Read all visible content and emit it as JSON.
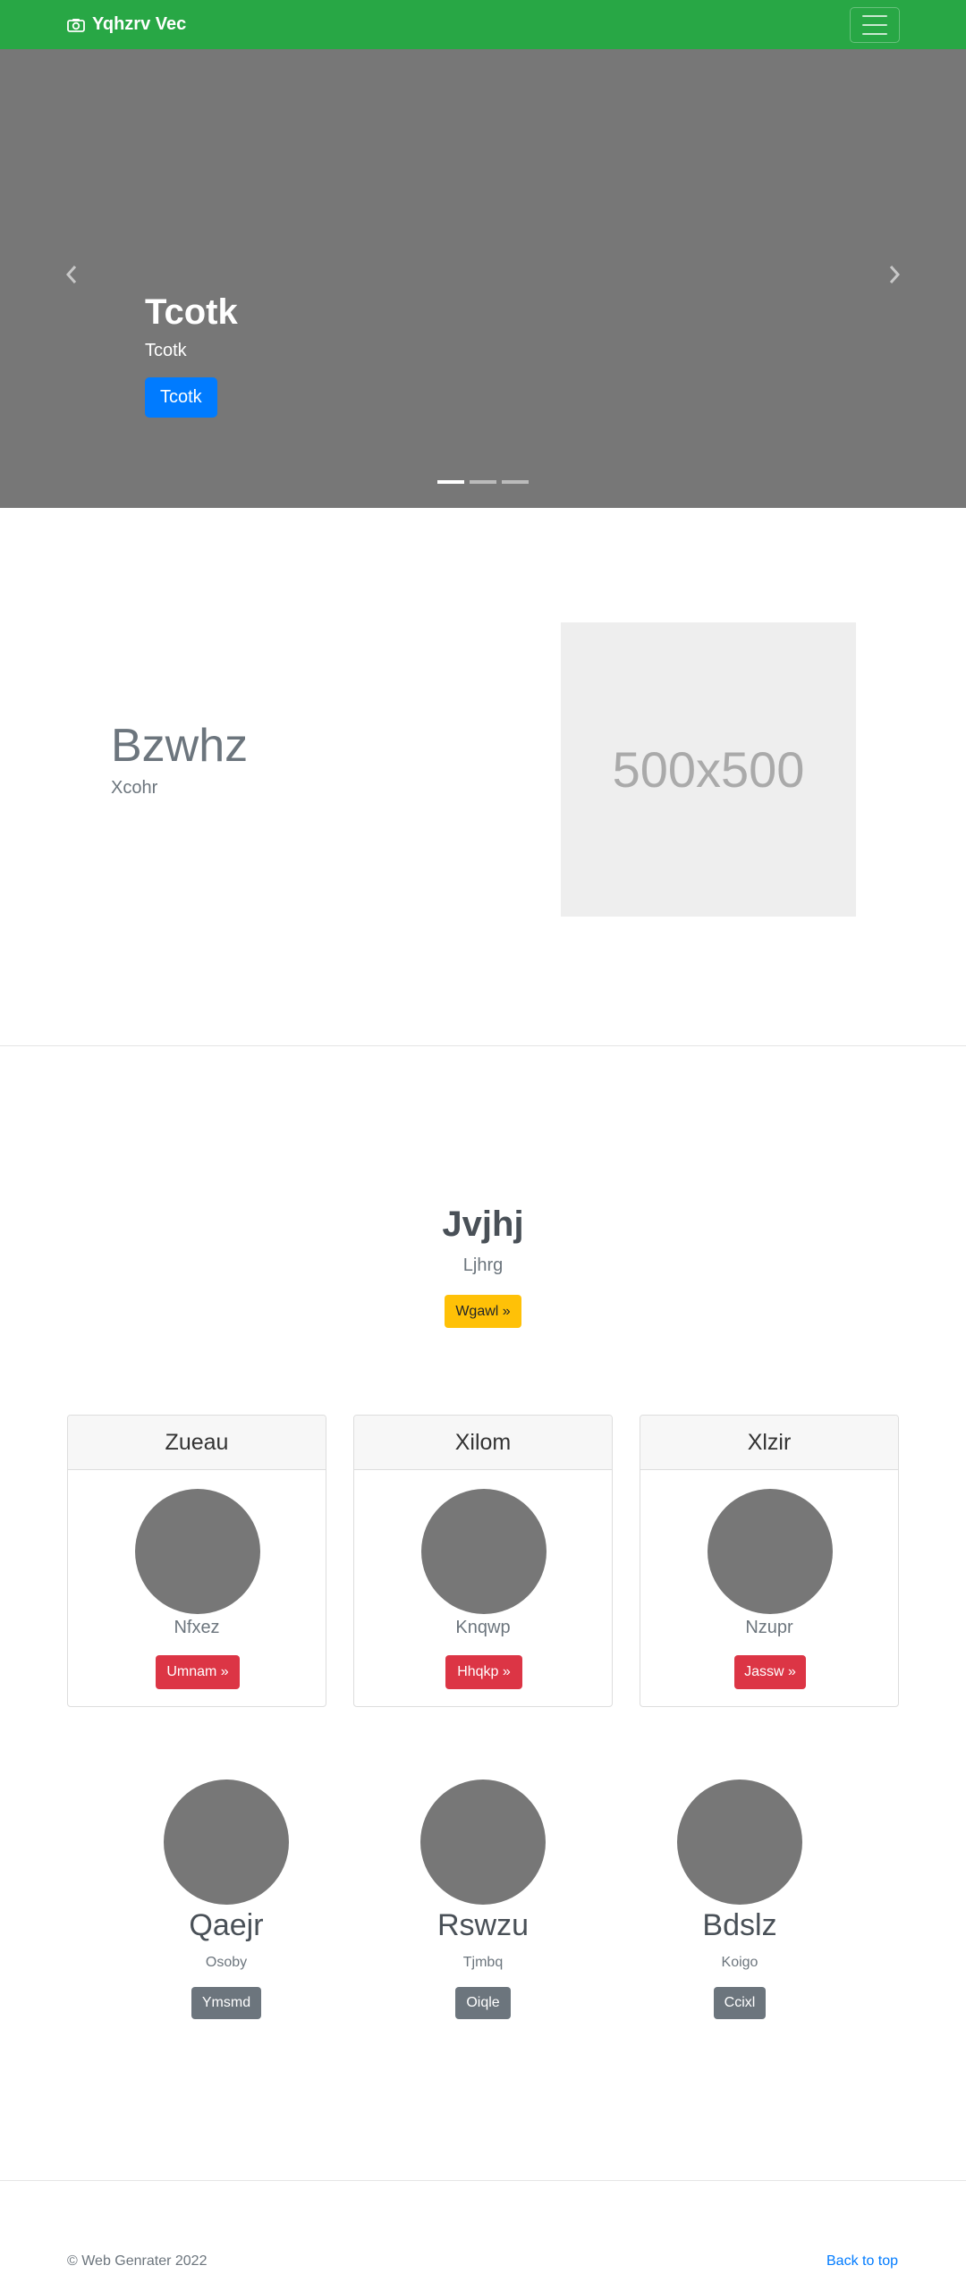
{
  "navbar": {
    "brand": "Yqhzrv Vec",
    "brand_icon": "camera-icon",
    "toggler_icon": "hamburger-icon",
    "bg_color": "#28a745"
  },
  "carousel": {
    "title": "Tcotk",
    "text": "Tcotk",
    "button": "Tcotk",
    "indicators": 3,
    "active_slide": 1,
    "prev_icon": "chevron-left-icon",
    "next_icon": "chevron-right-icon"
  },
  "featurette": {
    "heading": "Bzwhz",
    "lead": "Xcohr",
    "image_label": "500x500"
  },
  "jumbotron": {
    "title": "Jvjhj",
    "lead": "Ljhrg",
    "button": "Wgawl »"
  },
  "cards": [
    {
      "header": "Zueau",
      "text": "Nfxez",
      "button": "Umnam »"
    },
    {
      "header": "Xilom",
      "text": "Knqwp",
      "button": "Hhqkp »"
    },
    {
      "header": "Xlzir",
      "text": "Nzupr",
      "button": "Jassw »"
    }
  ],
  "people": [
    {
      "name": "Qaejr",
      "text": "Osoby",
      "button": "Ymsmd"
    },
    {
      "name": "Rswzu",
      "text": "Tjmbq",
      "button": "Oiqle"
    },
    {
      "name": "Bdslz",
      "text": "Koigo",
      "button": "Ccixl"
    }
  ],
  "footer": {
    "copyright": "© Web Genrater 2022",
    "back_to_top": "Back to top"
  }
}
